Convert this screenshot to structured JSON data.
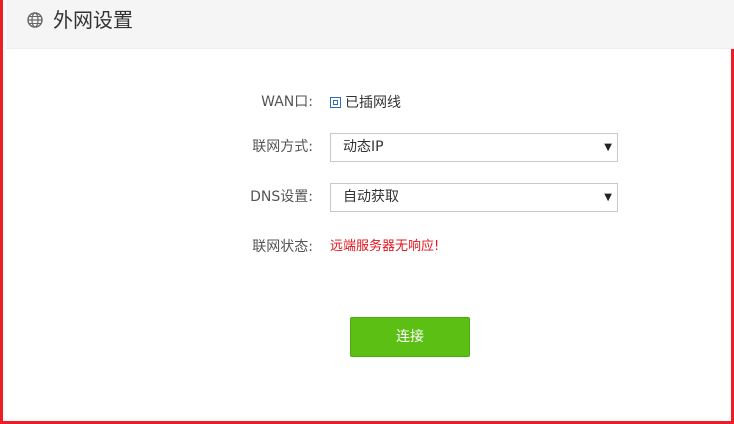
{
  "header": {
    "title": "外网设置",
    "icon": "globe-icon"
  },
  "form": {
    "wan_label": "WAN口:",
    "wan_status_text": "已插网线",
    "connection_type_label": "联网方式:",
    "connection_type_value": "动态IP",
    "dns_label": "DNS设置:",
    "dns_value": "自动获取",
    "net_status_label": "联网状态:",
    "net_status_value": "远端服务器无响应!"
  },
  "actions": {
    "connect_label": "连接"
  },
  "colors": {
    "frame_border": "#ee1c25",
    "button_green": "#5cc014",
    "error_red": "#e0161e",
    "checkbox_blue": "#2b6fb5"
  }
}
